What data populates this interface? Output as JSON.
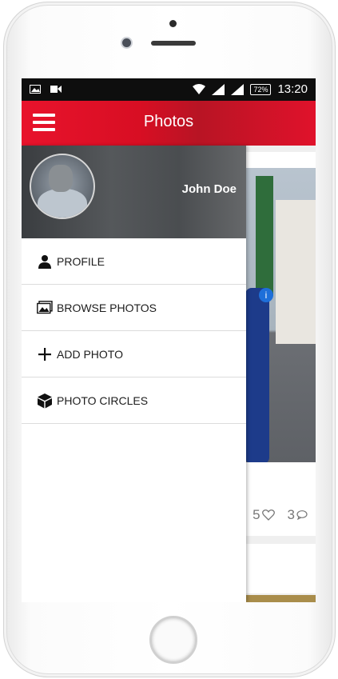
{
  "status_bar": {
    "time": "13:20",
    "battery": "72%"
  },
  "app_bar": {
    "title": "Photos",
    "menu_icon": "hamburger-menu-icon"
  },
  "drawer": {
    "user_name": "John Doe",
    "items": [
      {
        "label": "PROFILE",
        "icon": "person-icon"
      },
      {
        "label": "BROWSE PHOTOS",
        "icon": "image-icon"
      },
      {
        "label": "ADD PHOTO",
        "icon": "plus-icon"
      },
      {
        "label": "PHOTO CIRCLES",
        "icon": "cube-icon"
      }
    ]
  },
  "photo_card": {
    "likes": "5",
    "comments": "3"
  },
  "colors": {
    "accent": "#e8132c",
    "drawer_header": "#4a4d50"
  }
}
